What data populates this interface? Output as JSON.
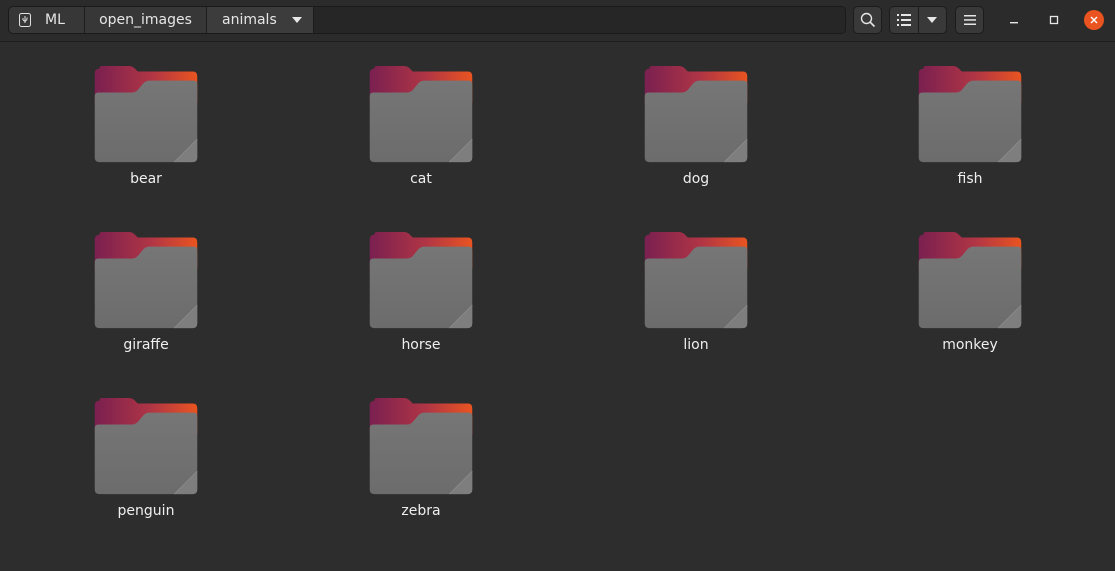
{
  "window": {
    "accent_color": "#e95420",
    "folder_tab_gradient": [
      "#7a2050",
      "#e95420"
    ],
    "folder_body_color": "#707070"
  },
  "pathbar": {
    "crumbs": [
      {
        "label": "ML",
        "icon": "usb-drive-icon"
      },
      {
        "label": "open_images"
      },
      {
        "label": "animals",
        "icon": "chevron-down-icon"
      }
    ]
  },
  "toolbar": {
    "search_icon": "search-icon",
    "view_icon": "list-view-icon",
    "view_options_icon": "chevron-down-icon",
    "menu_icon": "hamburger-menu-icon"
  },
  "window_controls": {
    "minimize_icon": "minimize-icon",
    "maximize_icon": "maximize-icon",
    "close_icon": "close-icon"
  },
  "folders": [
    {
      "name": "bear"
    },
    {
      "name": "cat"
    },
    {
      "name": "dog"
    },
    {
      "name": "fish"
    },
    {
      "name": "giraffe"
    },
    {
      "name": "horse"
    },
    {
      "name": "lion"
    },
    {
      "name": "monkey"
    },
    {
      "name": "penguin"
    },
    {
      "name": "zebra"
    }
  ]
}
